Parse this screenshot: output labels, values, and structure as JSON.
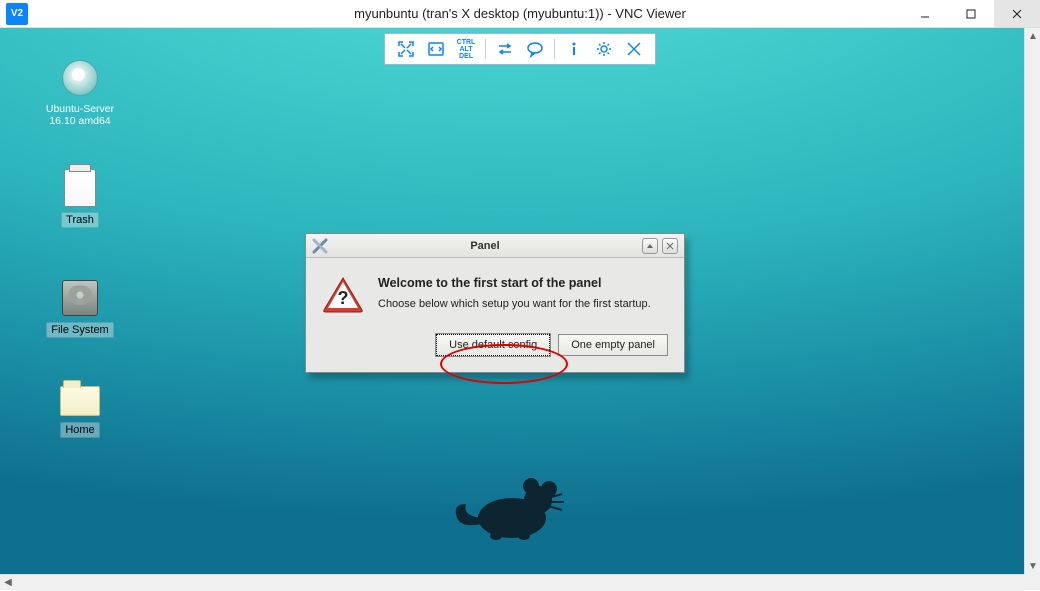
{
  "app": {
    "logo_text": "V2",
    "window_title": "myunbuntu (tran's X desktop (myubuntu:1)) - VNC Viewer"
  },
  "vnc_toolbar": {
    "ctrl_alt_del": "CTRL\nALT\nDEL"
  },
  "desktop": {
    "icons": {
      "cd": "Ubuntu-Server\n16.10 amd64",
      "trash": "Trash",
      "filesystem": "File System",
      "home": "Home"
    }
  },
  "dialog": {
    "title": "Panel",
    "heading": "Welcome to the first start of the panel",
    "body": "Choose below which setup you want for the first startup.",
    "button_default": "Use default config",
    "button_empty": "One empty panel"
  }
}
